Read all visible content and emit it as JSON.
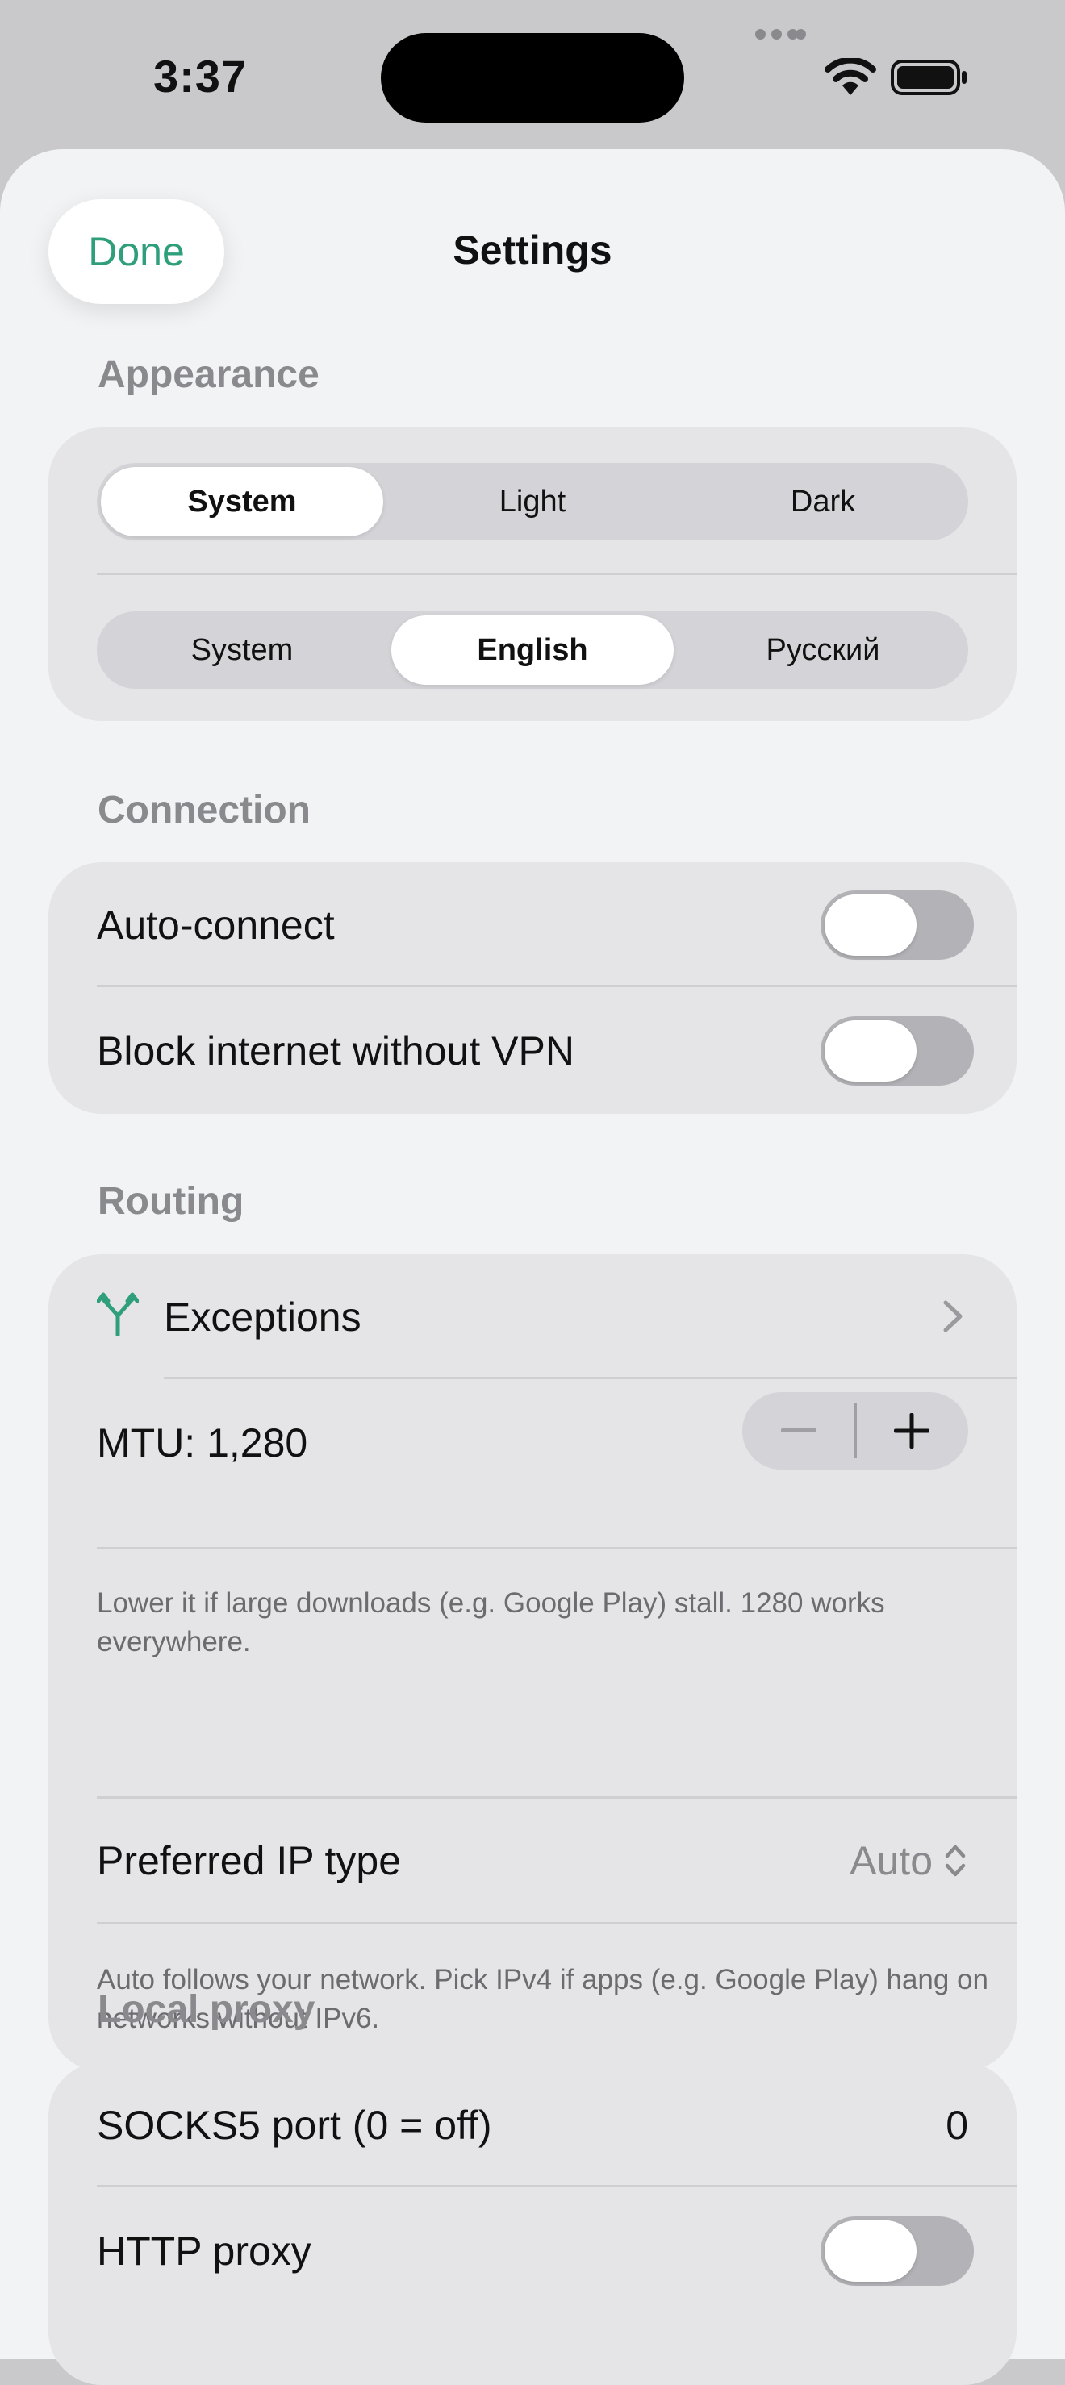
{
  "status_bar": {
    "time": "3:37"
  },
  "sheet": {
    "done_label": "Done",
    "title": "Settings"
  },
  "appearance": {
    "header": "Appearance",
    "theme_options": [
      "System",
      "Light",
      "Dark"
    ],
    "theme_selected": "System",
    "language_options": [
      "System",
      "English",
      "Русский"
    ],
    "language_selected": "English"
  },
  "connection": {
    "header": "Connection",
    "auto_connect_label": "Auto-connect",
    "auto_connect_on": false,
    "block_internet_label": "Block internet without VPN",
    "block_internet_on": false
  },
  "routing": {
    "header": "Routing",
    "exceptions_label": "Exceptions",
    "mtu_label": "MTU: 1,280",
    "mtu_note": "Lower it if large downloads (e.g. Google Play) stall. 1280 works everywhere.",
    "ip_type_label": "Preferred IP type",
    "ip_type_value": "Auto",
    "ip_type_note": "Auto follows your network. Pick IPv4 if apps (e.g. Google Play) hang on networks without IPv6."
  },
  "local_proxy": {
    "header": "Local proxy",
    "socks_label": "SOCKS5 port (0 = off)",
    "socks_value": "0",
    "http_label": "HTTP proxy",
    "http_on": false
  },
  "colors": {
    "accent": "#2e9e7b",
    "sheet_background": "#f2f3f5",
    "card_background": "#e5e5e8",
    "toggle_off": "#b3b3b7"
  }
}
